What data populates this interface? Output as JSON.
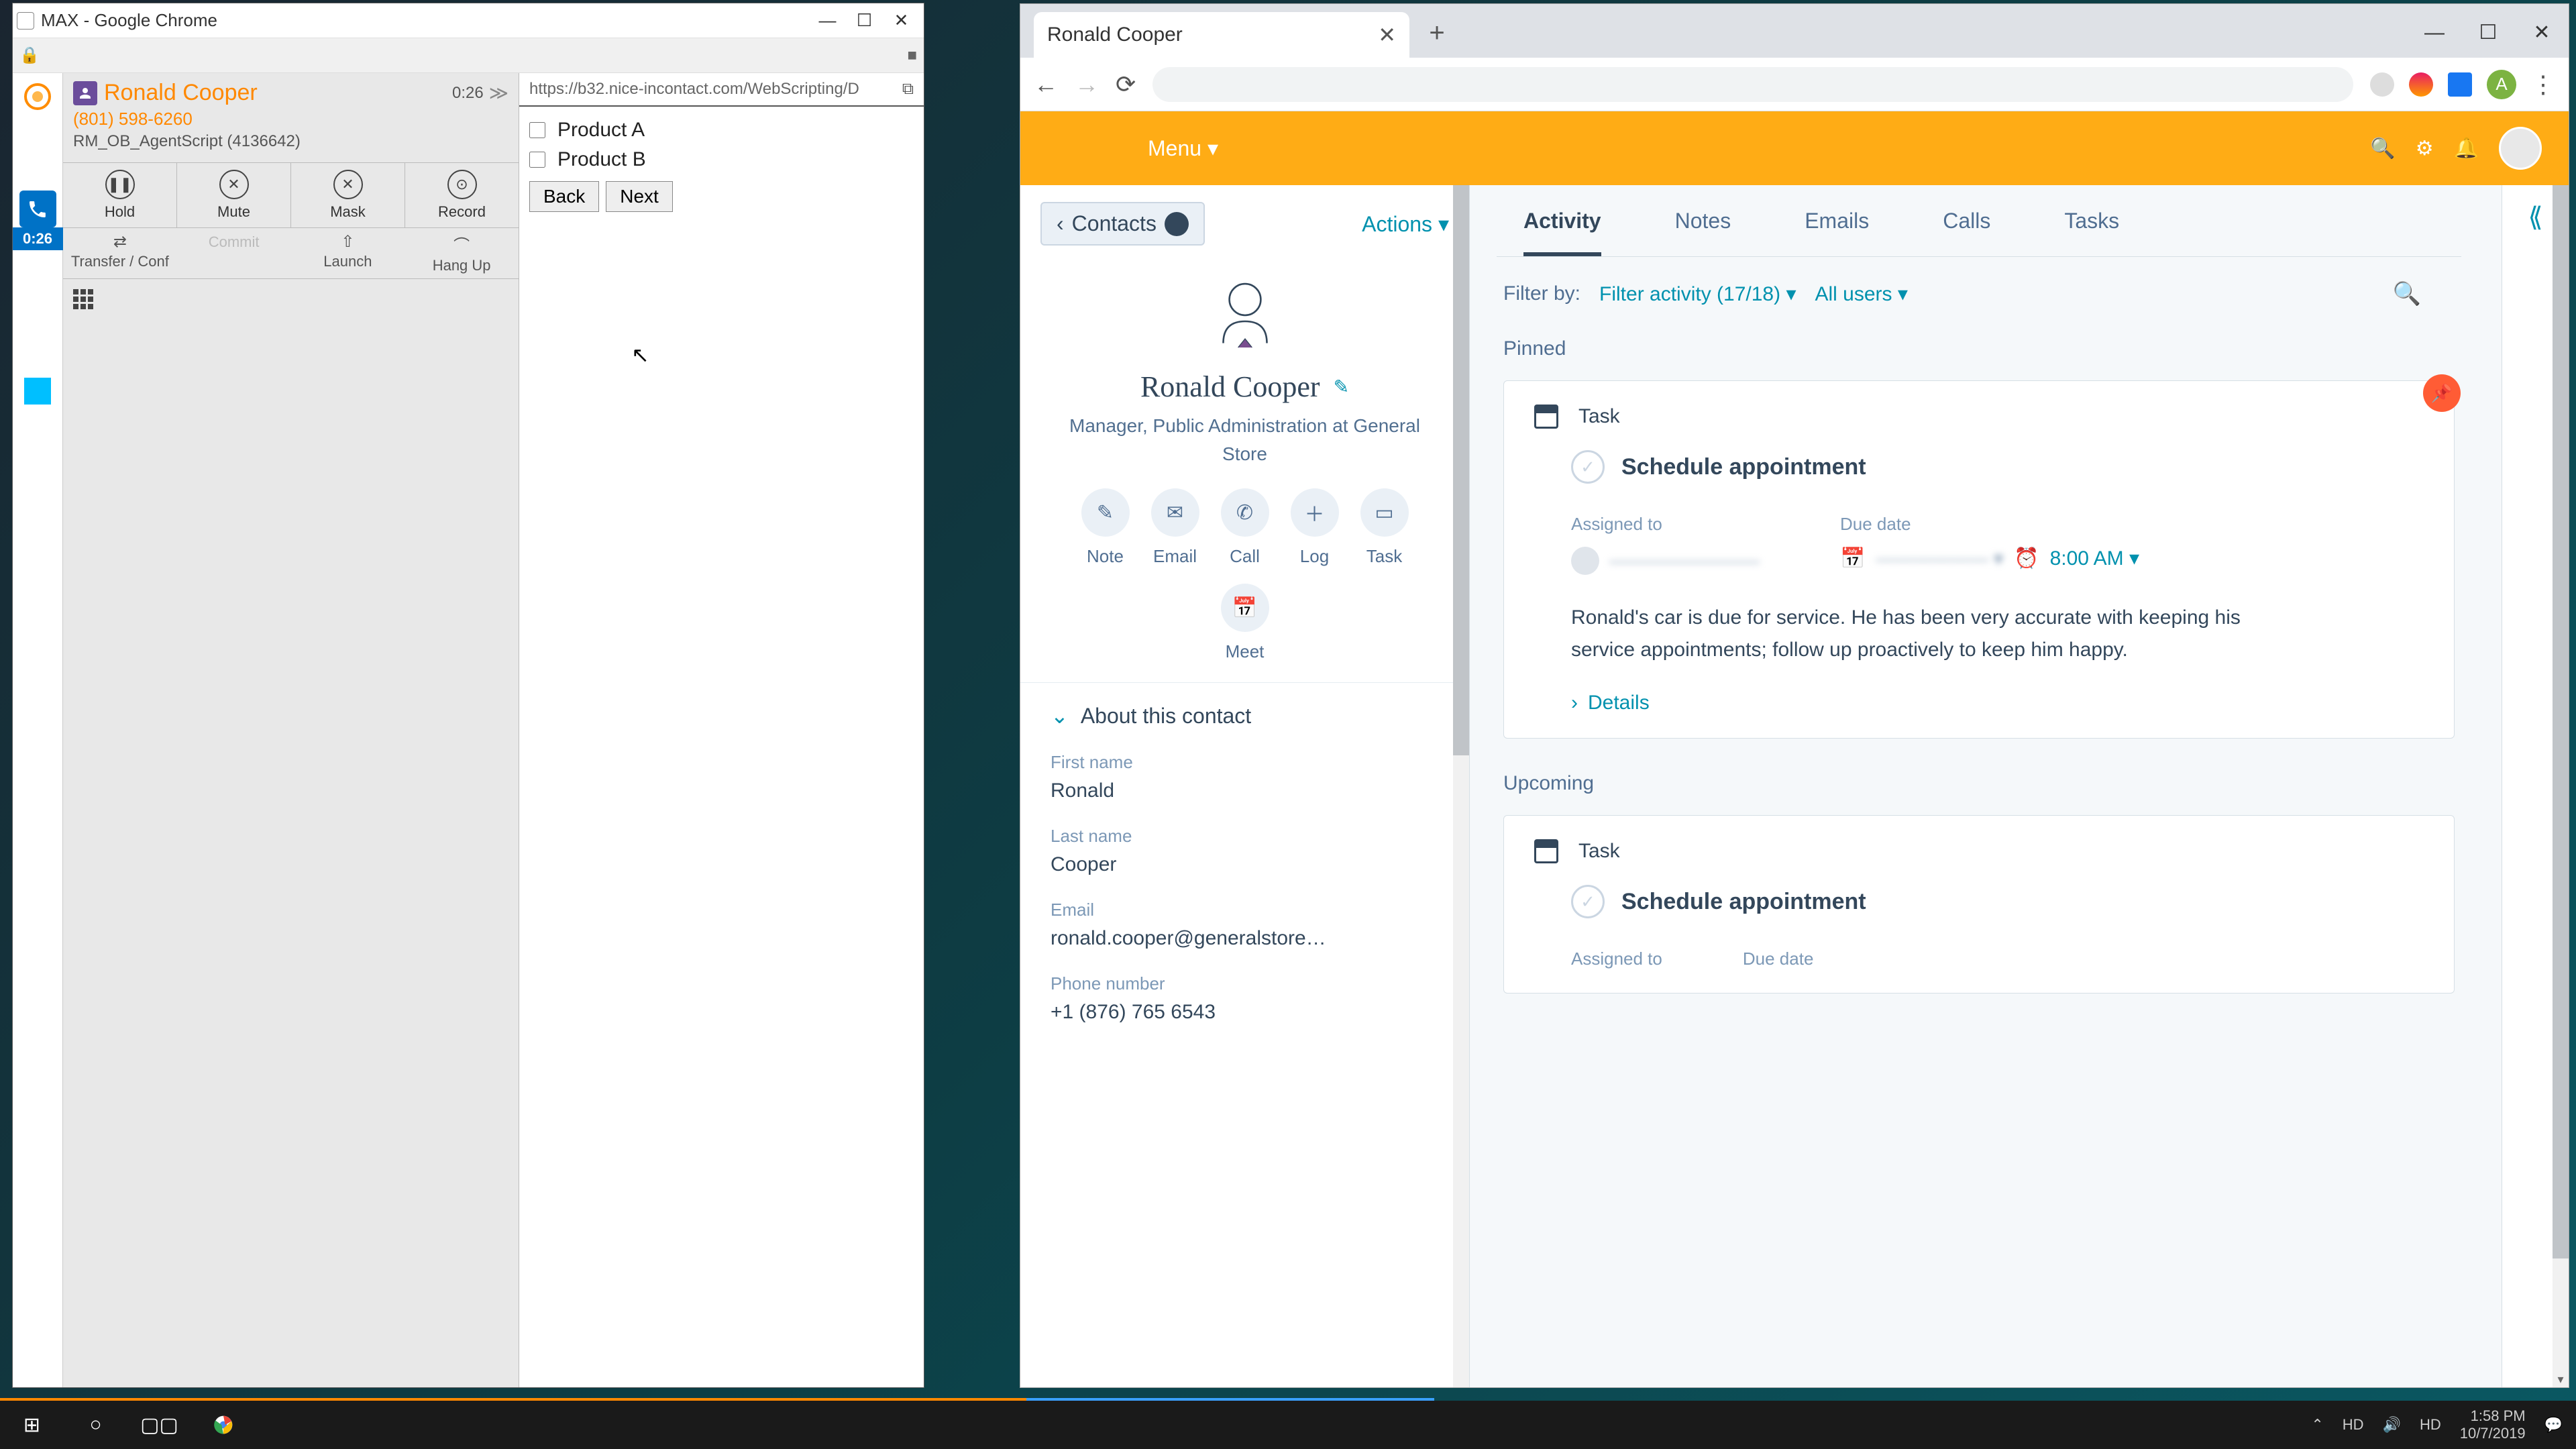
{
  "max": {
    "title": "MAX - Google Chrome",
    "timer": "0:26",
    "contact": {
      "name": "Ronald Cooper",
      "phone": "(801) 598-6260",
      "script_id": "RM_OB_AgentScript (4136642)",
      "elapsed": "0:26"
    },
    "controls": {
      "hold": "Hold",
      "mute": "Mute",
      "mask": "Mask",
      "record": "Record",
      "transfer": "Transfer / Conf",
      "commit": "Commit",
      "launch": "Launch",
      "hangup": "Hang Up"
    },
    "script": {
      "url": "https://b32.nice-incontact.com/WebScripting/D",
      "product_a": "Product A",
      "product_b": "Product B",
      "back": "Back",
      "next": "Next"
    }
  },
  "chrome": {
    "tab_title": "Ronald Cooper",
    "avatar_letter": "A"
  },
  "hubspot": {
    "menu": "Menu ▾",
    "contacts_label": "Contacts",
    "actions_label": "Actions ▾",
    "profile": {
      "name": "Ronald Cooper",
      "title": "Manager, Public Administration at General Store"
    },
    "action_buttons": {
      "note": "Note",
      "email": "Email",
      "call": "Call",
      "log": "Log",
      "task": "Task",
      "meet": "Meet"
    },
    "about": {
      "header": "About this contact",
      "first_name_label": "First name",
      "first_name": "Ronald",
      "last_name_label": "Last name",
      "last_name": "Cooper",
      "email_label": "Email",
      "email": "ronald.cooper@generalstore…",
      "phone_label": "Phone number",
      "phone": "+1 (876) 765 6543"
    },
    "tabs": {
      "activity": "Activity",
      "notes": "Notes",
      "emails": "Emails",
      "calls": "Calls",
      "tasks": "Tasks"
    },
    "filters": {
      "label": "Filter by:",
      "activity": "Filter activity (17/18) ▾",
      "users": "All users ▾"
    },
    "sections": {
      "pinned": "Pinned",
      "upcoming": "Upcoming"
    },
    "task_card": {
      "type": "Task",
      "subject": "Schedule appointment",
      "assigned_label": "Assigned to",
      "due_label": "Due date",
      "due_time": "8:00 AM ▾",
      "description": "Ronald's car is due for service. He has been very accurate with keeping his service appointments; follow up proactively to keep him happy.",
      "details": "Details"
    }
  },
  "taskbar": {
    "time": "1:58 PM",
    "date": "10/7/2019"
  }
}
